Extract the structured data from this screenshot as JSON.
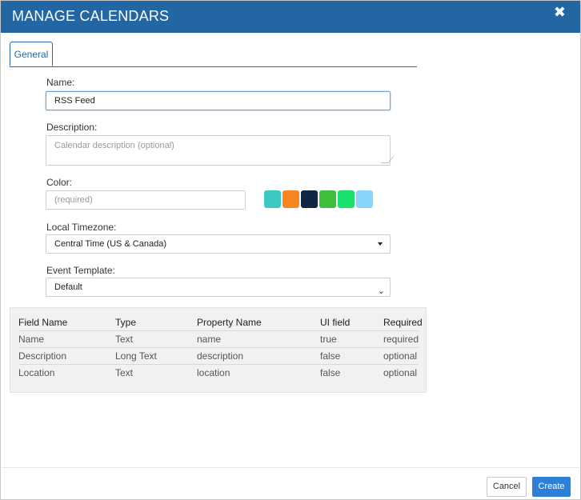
{
  "dialog": {
    "title": "MANAGE CALENDARS",
    "close_glyph": "✖"
  },
  "tabs": [
    {
      "label": "General",
      "active": true
    }
  ],
  "form": {
    "name": {
      "label": "Name:",
      "value": "RSS Feed"
    },
    "description": {
      "label": "Description:",
      "placeholder": "Calendar description (optional)"
    },
    "color": {
      "label": "Color:",
      "placeholder": "(required)",
      "swatches": [
        "#3cc9c4",
        "#f7861e",
        "#0f2744",
        "#3dbf3a",
        "#19e06d",
        "#86d6fa"
      ]
    },
    "timezone": {
      "label": "Local Timezone:",
      "value": "Central Time (US & Canada)"
    },
    "template": {
      "label": "Event Template:",
      "value": "Default"
    }
  },
  "fields_table": {
    "headers": [
      "Field Name",
      "Type",
      "Property Name",
      "UI field",
      "Required"
    ],
    "rows": [
      [
        "Name",
        "Text",
        "name",
        "true",
        "required"
      ],
      [
        "Description",
        "Long Text",
        "description",
        "false",
        "optional"
      ],
      [
        "Location",
        "Text",
        "location",
        "false",
        "optional"
      ]
    ]
  },
  "buttons": {
    "cancel": "Cancel",
    "create": "Create"
  },
  "colors": {
    "header_bg": "#2366a4",
    "primary": "#2d7fd8"
  }
}
